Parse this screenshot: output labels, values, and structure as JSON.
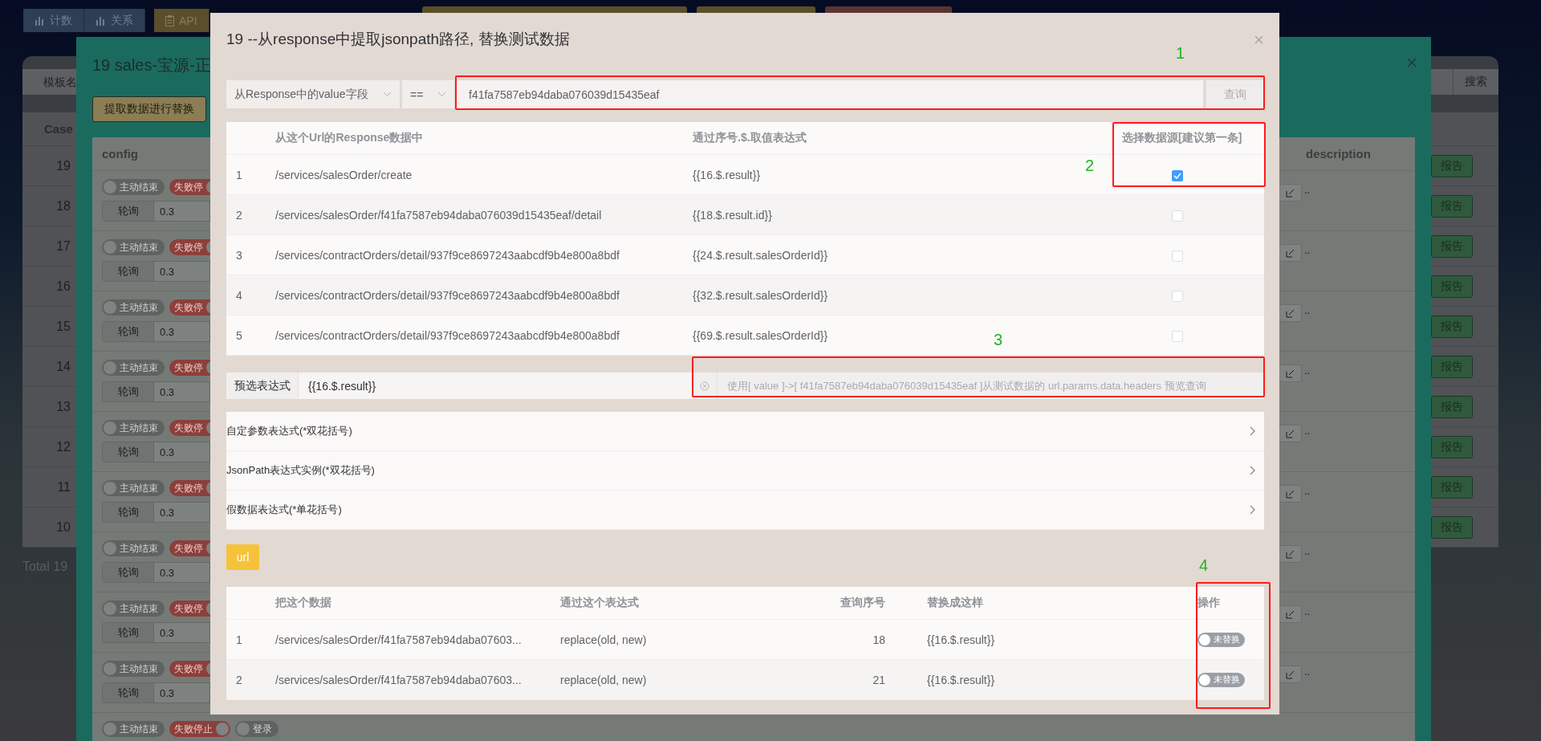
{
  "top_toolbar": [
    {
      "label": "计数"
    },
    {
      "label": "关系"
    },
    {
      "label": "API"
    }
  ],
  "back_panel": {
    "search_placeholder": "模板名",
    "search_button": "搜索",
    "id_header": "Case",
    "cases": [
      {
        "id": "19",
        "report_button": "报告"
      },
      {
        "id": "18",
        "report_button": "报告"
      },
      {
        "id": "17",
        "report_button": "报告"
      },
      {
        "id": "16",
        "report_button": "报告"
      },
      {
        "id": "15",
        "report_button": "报告"
      },
      {
        "id": "14",
        "report_button": "报告"
      },
      {
        "id": "13",
        "report_button": "报告"
      },
      {
        "id": "12",
        "report_button": "报告"
      },
      {
        "id": "11",
        "report_button": "报告"
      },
      {
        "id": "10",
        "report_button": "报告"
      }
    ],
    "total": "Total 19"
  },
  "case_dialog": {
    "title": "19 sales-宝源-正",
    "action_button": "提取数据进行替换",
    "columns": [
      "config",
      "description"
    ],
    "rows": [
      {
        "switches": [
          {
            "label": "主动结束",
            "on": false
          },
          {
            "label": "失败停",
            "on": true
          }
        ],
        "mode": "轮询",
        "interval": "0.3",
        "edit_suffix": ".."
      },
      {
        "switches": [
          {
            "label": "主动结束",
            "on": false
          },
          {
            "label": "失败停",
            "on": true
          }
        ],
        "mode": "轮询",
        "interval": "0.3",
        "edit_suffix": ".."
      },
      {
        "switches": [
          {
            "label": "主动结束",
            "on": false
          },
          {
            "label": "失败停",
            "on": true
          }
        ],
        "mode": "轮询",
        "interval": "0.3",
        "edit_suffix": ".."
      },
      {
        "switches": [
          {
            "label": "主动结束",
            "on": false
          },
          {
            "label": "失败停",
            "on": true
          }
        ],
        "mode": "轮询",
        "interval": "0.3",
        "edit_suffix": ".."
      },
      {
        "switches": [
          {
            "label": "主动结束",
            "on": false
          },
          {
            "label": "失败停",
            "on": true
          }
        ],
        "mode": "轮询",
        "interval": "0.3",
        "edit_suffix": ".."
      },
      {
        "switches": [
          {
            "label": "主动结束",
            "on": false
          },
          {
            "label": "失败停",
            "on": true
          }
        ],
        "mode": "轮询",
        "interval": "0.3",
        "edit_suffix": ".."
      },
      {
        "switches": [
          {
            "label": "主动结束",
            "on": false
          },
          {
            "label": "失败停",
            "on": true
          }
        ],
        "mode": "轮询",
        "interval": "0.3",
        "edit_suffix": ".."
      },
      {
        "switches": [
          {
            "label": "主动结束",
            "on": false
          },
          {
            "label": "失败停",
            "on": true
          }
        ],
        "mode": "轮询",
        "interval": "0.3",
        "edit_suffix": ".."
      },
      {
        "switches": [
          {
            "label": "主动结束",
            "on": false
          },
          {
            "label": "失败停",
            "on": true
          }
        ],
        "mode": "轮询",
        "interval": "0.3",
        "edit_suffix": ".."
      },
      {
        "switches": [
          {
            "label": "主动结束",
            "on": false
          },
          {
            "label": "失败停止",
            "on": true
          },
          {
            "label": "登录",
            "on": false
          }
        ]
      }
    ]
  },
  "modal": {
    "title": "19 --从response中提取jsonpath路径, 替换测试数据",
    "filter": {
      "field_select": "从Response中的value字段",
      "operator_select": "==",
      "value": "f41fa7587eb94daba076039d15435eaf",
      "query_button": "查询"
    },
    "source_table": {
      "columns": [
        "从这个Url的Response数据中",
        "通过序号.$.取值表达式",
        "选择数据源[建议第一条]"
      ],
      "rows": [
        {
          "index": "1",
          "url": "/services/salesOrder/create",
          "expression": "{{16.$.result}}",
          "selected": true
        },
        {
          "index": "2",
          "url": "/services/salesOrder/f41fa7587eb94daba076039d15435eaf/detail",
          "expression": "{{18.$.result.id}}",
          "selected": false
        },
        {
          "index": "3",
          "url": "/services/contractOrders/detail/937f9ce8697243aabcdf9b4e800a8bdf",
          "expression": "{{24.$.result.salesOrderId}}",
          "selected": false
        },
        {
          "index": "4",
          "url": "/services/contractOrders/detail/937f9ce8697243aabcdf9b4e800a8bdf",
          "expression": "{{32.$.result.salesOrderId}}",
          "selected": false
        },
        {
          "index": "5",
          "url": "/services/contractOrders/detail/937f9ce8697243aabcdf9b4e800a8bdf",
          "expression": "{{69.$.result.salesOrderId}}",
          "selected": false
        }
      ]
    },
    "preselect": {
      "label": "预选表达式",
      "value": "{{16.$.result}}",
      "preview_placeholder": "使用[ value ]->[ f41fa7587eb94daba076039d15435eaf ]从测试数据的 url.params.data.headers 预览查询"
    },
    "collapse_panels": [
      {
        "title": "自定参数表达式(*双花括号)",
        "expanded": false
      },
      {
        "title": "JsonPath表达式实例(*双花括号)",
        "expanded": false
      },
      {
        "title": "假数据表达式(*单花括号)",
        "expanded": false
      }
    ],
    "data_type_button": "url",
    "replace_table": {
      "columns": [
        "把这个数据",
        "通过这个表达式",
        "查询序号",
        "替换成这样",
        "操作"
      ],
      "rows": [
        {
          "index": "1",
          "data": "/services/salesOrder/f41fa7587eb94daba07603...",
          "method": "replace(old, new)",
          "query_index": "18",
          "replacement": "{{16.$.result}}",
          "switch_label": "未替换",
          "on": false
        },
        {
          "index": "2",
          "data": "/services/salesOrder/f41fa7587eb94daba07603...",
          "method": "replace(old, new)",
          "query_index": "21",
          "replacement": "{{16.$.result}}",
          "switch_label": "未替换",
          "on": false
        }
      ]
    },
    "annotations": [
      {
        "label": "1"
      },
      {
        "label": "2"
      },
      {
        "label": "3"
      },
      {
        "label": "4"
      }
    ]
  }
}
